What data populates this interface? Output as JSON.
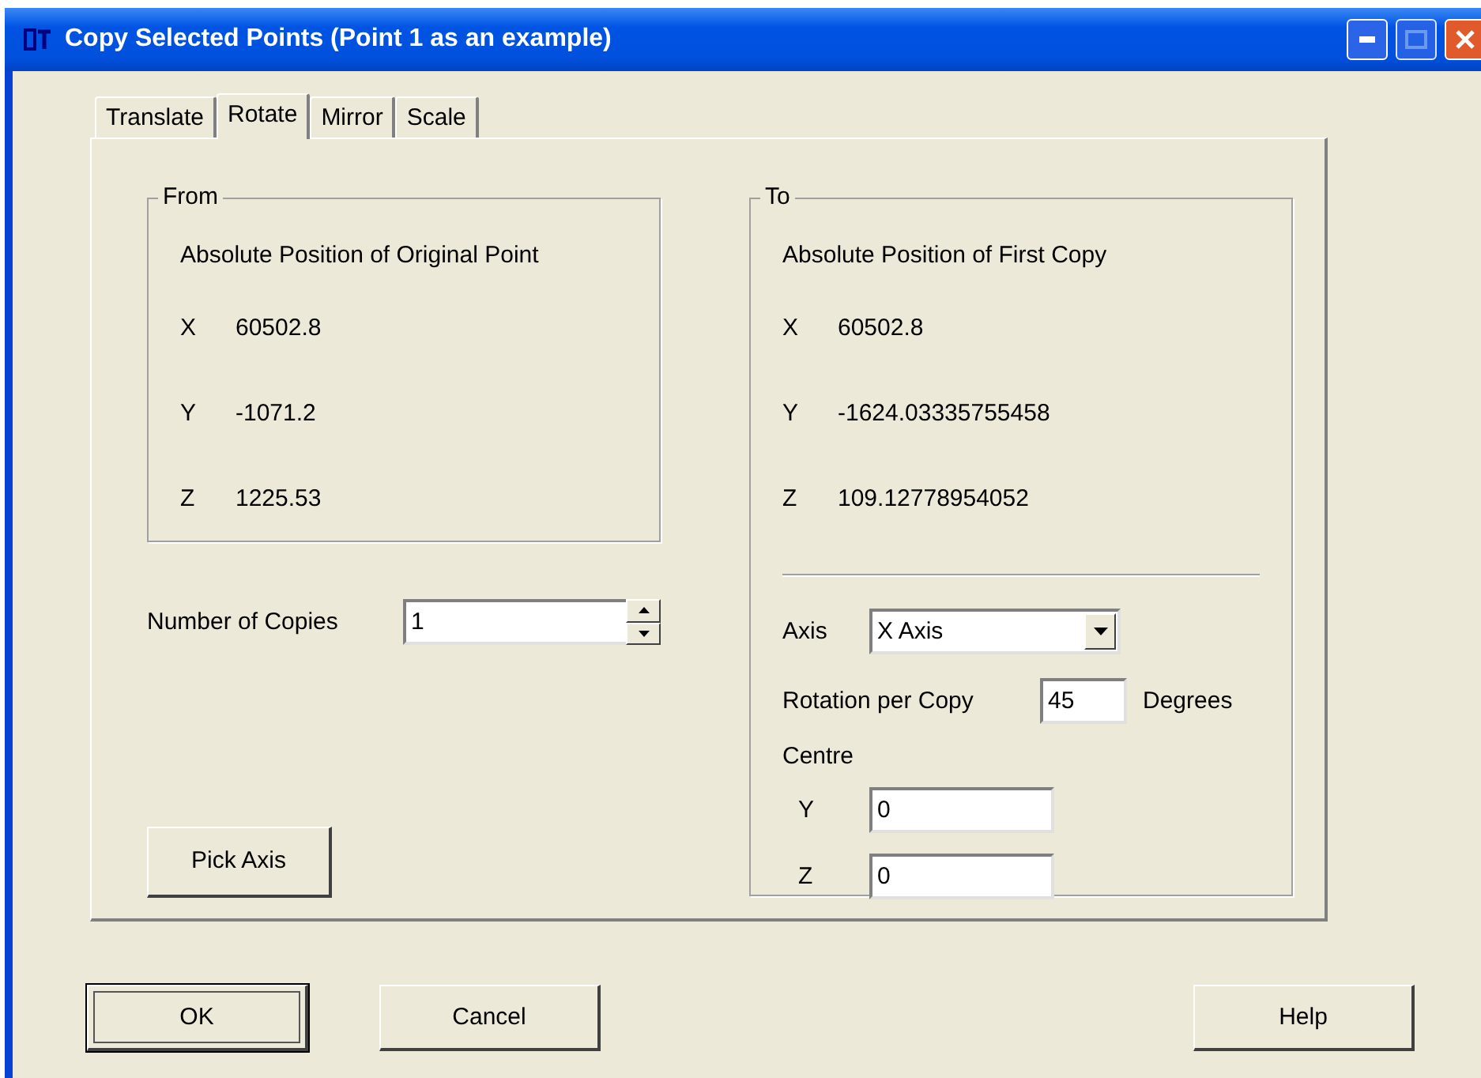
{
  "window": {
    "title": "Copy Selected Points (Point 1 as an example)"
  },
  "tabs": [
    {
      "label": "Translate",
      "selected": false
    },
    {
      "label": "Rotate",
      "selected": true
    },
    {
      "label": "Mirror",
      "selected": false
    },
    {
      "label": "Scale",
      "selected": false
    }
  ],
  "from": {
    "legend": "From",
    "heading": "Absolute Position of Original Point",
    "coords": [
      {
        "axis": "X",
        "value": "60502.8"
      },
      {
        "axis": "Y",
        "value": "-1071.2"
      },
      {
        "axis": "Z",
        "value": "1225.53"
      }
    ]
  },
  "copies": {
    "label": "Number of Copies",
    "value": "1"
  },
  "pick_axis_button": "Pick Axis",
  "to": {
    "legend": "To",
    "heading": "Absolute Position of First Copy",
    "coords": [
      {
        "axis": "X",
        "value": "60502.8"
      },
      {
        "axis": "Y",
        "value": "-1624.03335755458"
      },
      {
        "axis": "Z",
        "value": "109.12778954052"
      }
    ],
    "axis": {
      "label": "Axis",
      "value": "X Axis"
    },
    "rotation": {
      "label": "Rotation per Copy",
      "value": "45",
      "unit": "Degrees"
    },
    "centre": {
      "label": "Centre",
      "coords": [
        {
          "axis": "Y",
          "value": "0"
        },
        {
          "axis": "Z",
          "value": "0"
        }
      ]
    }
  },
  "buttons": [
    {
      "label": "OK",
      "default": true
    },
    {
      "label": "Cancel",
      "default": false
    },
    {
      "label": "Help",
      "default": false
    }
  ]
}
